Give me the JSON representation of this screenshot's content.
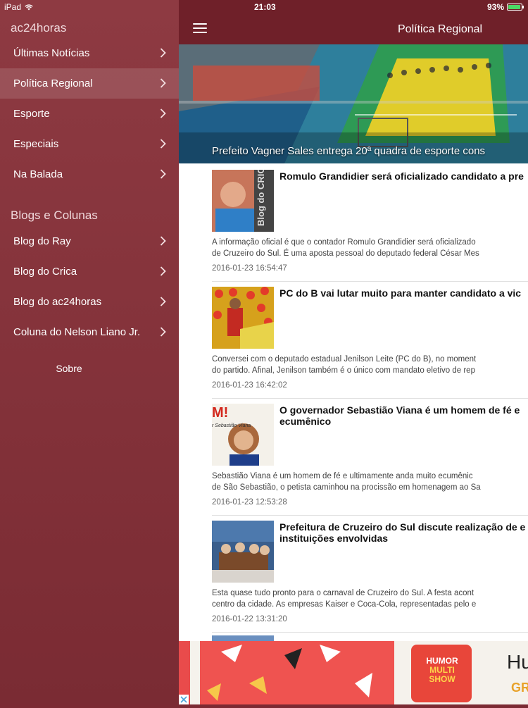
{
  "status": {
    "device": "iPad",
    "time": "21:03",
    "battery": "93%"
  },
  "sidebar": {
    "app_title": "ac24horas",
    "menu": [
      {
        "label": "Últimas Notícias",
        "active": false
      },
      {
        "label": "Política Regional",
        "active": true
      },
      {
        "label": "Esporte",
        "active": false
      },
      {
        "label": "Especiais",
        "active": false
      },
      {
        "label": "Na Balada",
        "active": false
      }
    ],
    "blogs_title": "Blogs e Colunas",
    "blogs": [
      {
        "label": "Blog do Ray"
      },
      {
        "label": "Blog do Crica"
      },
      {
        "label": "Blog do ac24horas"
      },
      {
        "label": "Coluna do Nelson Liano Jr."
      }
    ],
    "about": "Sobre"
  },
  "header": {
    "title": "Política Regional"
  },
  "hero": {
    "caption": "Prefeito Vagner Sales entrega 20ª quadra de esporte cons"
  },
  "articles": [
    {
      "title": "Romulo Grandidier será oficializado candidato a pre",
      "summary1": "A informação oficial é que o contador Romulo Grandidier será oficializado",
      "summary2": "de Cruzeiro do Sul. É uma aposta pessoal do deputado federal César Mes",
      "date": "2016-01-23 16:54:47",
      "thumb_text": "Blog do CRICA"
    },
    {
      "title": "PC do B vai lutar muito para manter candidato a vic",
      "summary1": "Conversei com o deputado estadual Jenilson Leite (PC do B), no moment",
      "summary2": "do partido. Afinal, Jenilson também é o único com mandato eletivo de rep",
      "date": "2016-01-23 16:42:02"
    },
    {
      "title": "O governador Sebastião Viana é um homem de fé e ecumênico",
      "summary1": "Sebastião Viana é um homem de fé e ultimamente anda muito ecumênic",
      "summary2": "de São Sebastião, o petista caminhou na procissão em homenagem ao Sa",
      "date": "2016-01-23 12:53:28",
      "thumb_text": "M!",
      "thumb_text2": "r Sebastião Viana"
    },
    {
      "title": "Prefeitura de Cruzeiro do Sul discute realização de e instituições envolvidas",
      "summary1": "Esta quase tudo pronto para o carnaval de Cruzeiro do Sul. A festa acont",
      "summary2": "centro da cidade. As empresas Kaiser e Coca-Cola, representadas pelo e",
      "date": "2016-01-22 13:31:20"
    }
  ],
  "ad": {
    "logo_line1": "HUMOR",
    "logo_line2": "MULTI",
    "logo_line3": "SHOW",
    "text_big": "Hu",
    "text_small": "GR"
  },
  "colors": {
    "sidebar": "#8e3a42",
    "topbar": "#6f2029",
    "battery": "#4cd964"
  }
}
